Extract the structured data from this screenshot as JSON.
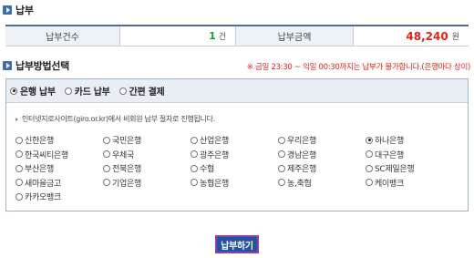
{
  "payment": {
    "title": "납부",
    "count_label": "납부건수",
    "count_value": "1",
    "count_unit": "건",
    "amount_label": "납부금액",
    "amount_value": "48,240",
    "amount_unit": "원"
  },
  "method": {
    "title": "납부방법선택",
    "notice": "※ 금일 23:30 ~ 익일 00:30까지는 납부가 불가합니다.(은행마다 상이)",
    "tabs": [
      {
        "label": "은행 납부",
        "selected": true
      },
      {
        "label": "카드 납부",
        "selected": false
      },
      {
        "label": "간편 결제",
        "selected": false
      }
    ],
    "info": "인터넷지로사이트(giro.or.kr)에서 비회원 납부 절차로 진행됩니다.",
    "banks": [
      {
        "label": "신한은행",
        "selected": false
      },
      {
        "label": "국민은행",
        "selected": false
      },
      {
        "label": "산업은행",
        "selected": false
      },
      {
        "label": "우리은행",
        "selected": false
      },
      {
        "label": "하나은행",
        "selected": true
      },
      {
        "label": "한국씨티은행",
        "selected": false
      },
      {
        "label": "우체국",
        "selected": false
      },
      {
        "label": "광주은행",
        "selected": false
      },
      {
        "label": "경남은행",
        "selected": false
      },
      {
        "label": "대구은행",
        "selected": false
      },
      {
        "label": "부산은행",
        "selected": false
      },
      {
        "label": "전북은행",
        "selected": false
      },
      {
        "label": "수협",
        "selected": false
      },
      {
        "label": "제주은행",
        "selected": false
      },
      {
        "label": "SC제일은행",
        "selected": false
      },
      {
        "label": "새마을금고",
        "selected": false
      },
      {
        "label": "기업은행",
        "selected": false
      },
      {
        "label": "농협은행",
        "selected": false
      },
      {
        "label": "농,축협",
        "selected": false
      },
      {
        "label": "케이뱅크",
        "selected": false
      },
      {
        "label": "카카오뱅크",
        "selected": false
      }
    ]
  },
  "actions": {
    "pay_label": "납부하기"
  },
  "colors": {
    "accent": "#3b6db3",
    "count": "#1c9a2b",
    "amount": "#e2231a",
    "button": "#23559e",
    "button_border": "#8d3fb3"
  }
}
